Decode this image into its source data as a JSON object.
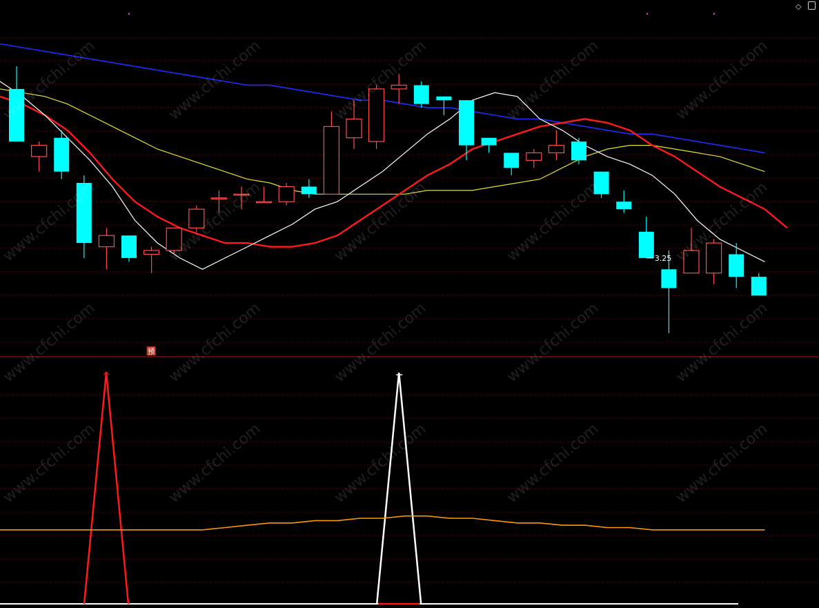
{
  "watermark_text": "www.cfchi.com",
  "colors": {
    "background": "#000000",
    "up": "#ff4c4c",
    "down": "#00ffff",
    "ma_short": "#ffffff",
    "ma_mid": "#ff1a1a",
    "ma_long": "#e6e22a",
    "ma_longest": "#1f2cff",
    "signal_red": "#ff1a1a",
    "signal_white": "#ffffff",
    "indicator_line": "#ff9900",
    "grid": "#7a1010",
    "divider": "#b01a1a"
  },
  "icons": {
    "corner_left": "diamond-icon",
    "corner_right": "square-icon"
  },
  "main_chart": {
    "low_label": "3.25",
    "low_marker_bar": 28,
    "pre_marker_label": "预",
    "pre_marker_bar": 6,
    "candles": [
      {
        "o": 3.9,
        "h": 3.96,
        "l": 3.76,
        "c": 3.76
      },
      {
        "o": 3.72,
        "h": 3.76,
        "l": 3.68,
        "c": 3.75
      },
      {
        "o": 3.77,
        "h": 3.79,
        "l": 3.66,
        "c": 3.68
      },
      {
        "o": 3.65,
        "h": 3.67,
        "l": 3.45,
        "c": 3.49
      },
      {
        "o": 3.48,
        "h": 3.53,
        "l": 3.42,
        "c": 3.51
      },
      {
        "o": 3.51,
        "h": 3.51,
        "l": 3.44,
        "c": 3.45
      },
      {
        "o": 3.46,
        "h": 3.48,
        "l": 3.41,
        "c": 3.47
      },
      {
        "o": 3.47,
        "h": 3.53,
        "l": 3.46,
        "c": 3.53
      },
      {
        "o": 3.53,
        "h": 3.59,
        "l": 3.52,
        "c": 3.58
      },
      {
        "o": 3.61,
        "h": 3.63,
        "l": 3.57,
        "c": 3.61
      },
      {
        "o": 3.62,
        "h": 3.64,
        "l": 3.58,
        "c": 3.62
      },
      {
        "o": 3.6,
        "h": 3.64,
        "l": 3.6,
        "c": 3.6
      },
      {
        "o": 3.6,
        "h": 3.65,
        "l": 3.59,
        "c": 3.64
      },
      {
        "o": 3.64,
        "h": 3.66,
        "l": 3.61,
        "c": 3.62
      },
      {
        "o": 3.62,
        "h": 3.84,
        "l": 3.62,
        "c": 3.8
      },
      {
        "o": 3.77,
        "h": 3.87,
        "l": 3.74,
        "c": 3.82
      },
      {
        "o": 3.76,
        "h": 3.91,
        "l": 3.74,
        "c": 3.9
      },
      {
        "o": 3.9,
        "h": 3.94,
        "l": 3.86,
        "c": 3.91
      },
      {
        "o": 3.91,
        "h": 3.92,
        "l": 3.85,
        "c": 3.86
      },
      {
        "o": 3.88,
        "h": 3.88,
        "l": 3.83,
        "c": 3.87
      },
      {
        "o": 3.87,
        "h": 3.87,
        "l": 3.71,
        "c": 3.75
      },
      {
        "o": 3.77,
        "h": 3.77,
        "l": 3.73,
        "c": 3.75
      },
      {
        "o": 3.73,
        "h": 3.73,
        "l": 3.67,
        "c": 3.69
      },
      {
        "o": 3.71,
        "h": 3.74,
        "l": 3.69,
        "c": 3.73
      },
      {
        "o": 3.73,
        "h": 3.79,
        "l": 3.71,
        "c": 3.75
      },
      {
        "o": 3.76,
        "h": 3.77,
        "l": 3.7,
        "c": 3.71
      },
      {
        "o": 3.68,
        "h": 3.68,
        "l": 3.61,
        "c": 3.62
      },
      {
        "o": 3.6,
        "h": 3.63,
        "l": 3.57,
        "c": 3.58
      },
      {
        "o": 3.52,
        "h": 3.56,
        "l": 3.45,
        "c": 3.45
      },
      {
        "o": 3.42,
        "h": 3.47,
        "l": 3.25,
        "c": 3.37
      },
      {
        "o": 3.41,
        "h": 3.53,
        "l": 3.41,
        "c": 3.47
      },
      {
        "o": 3.41,
        "h": 3.5,
        "l": 3.38,
        "c": 3.49
      },
      {
        "o": 3.46,
        "h": 3.49,
        "l": 3.37,
        "c": 3.4
      },
      {
        "o": 3.4,
        "h": 3.41,
        "l": 3.35,
        "c": 3.35
      }
    ],
    "ma_short": [
      3.92,
      3.88,
      3.83,
      3.77,
      3.71,
      3.64,
      3.55,
      3.49,
      3.45,
      3.42,
      3.45,
      3.48,
      3.51,
      3.54,
      3.58,
      3.6,
      3.64,
      3.68,
      3.73,
      3.78,
      3.82,
      3.87,
      3.89,
      3.88,
      3.82,
      3.79,
      3.75,
      3.72,
      3.7,
      3.67,
      3.62,
      3.55,
      3.5,
      3.47,
      3.44
    ],
    "ma_mid": [
      3.88,
      3.86,
      3.83,
      3.79,
      3.73,
      3.66,
      3.6,
      3.56,
      3.53,
      3.51,
      3.49,
      3.49,
      3.48,
      3.48,
      3.49,
      3.51,
      3.55,
      3.59,
      3.63,
      3.67,
      3.7,
      3.74,
      3.76,
      3.78,
      3.8,
      3.81,
      3.82,
      3.81,
      3.79,
      3.75,
      3.72,
      3.68,
      3.64,
      3.61,
      3.58,
      3.53
    ],
    "ma_long": [
      3.9,
      3.89,
      3.88,
      3.86,
      3.83,
      3.8,
      3.77,
      3.74,
      3.72,
      3.7,
      3.68,
      3.66,
      3.65,
      3.63,
      3.62,
      3.62,
      3.62,
      3.62,
      3.62,
      3.63,
      3.63,
      3.63,
      3.64,
      3.65,
      3.66,
      3.69,
      3.72,
      3.74,
      3.75,
      3.75,
      3.74,
      3.73,
      3.72,
      3.7,
      3.68
    ],
    "ma_longest": [
      4.02,
      4.01,
      4.0,
      3.99,
      3.98,
      3.97,
      3.96,
      3.95,
      3.94,
      3.93,
      3.92,
      3.91,
      3.91,
      3.9,
      3.89,
      3.88,
      3.87,
      3.87,
      3.86,
      3.85,
      3.85,
      3.84,
      3.83,
      3.82,
      3.82,
      3.81,
      3.8,
      3.79,
      3.78,
      3.78,
      3.77,
      3.76,
      3.75,
      3.74,
      3.73
    ]
  },
  "chart_data": {
    "type": "candlestick",
    "title": "",
    "xlabel": "",
    "ylabel": "",
    "ylim": [
      3.2,
      4.1
    ],
    "grid": true,
    "notes_in_chart": [
      "3.25",
      "预"
    ]
  },
  "indicator": {
    "ylim": [
      0,
      100
    ],
    "baseline": [
      0,
      0,
      0,
      0,
      0,
      0,
      0,
      0,
      0,
      0,
      0,
      0,
      0,
      0,
      0,
      0,
      0,
      0,
      0,
      0,
      0,
      0,
      0,
      0,
      0,
      0,
      0,
      0,
      0,
      0,
      0,
      0,
      0,
      0,
      0
    ],
    "signal_red": {
      "center_bar": 5,
      "height": 100
    },
    "signal_white": {
      "center_bar": 17,
      "height": 100
    },
    "smooth_line": [
      32,
      32,
      32,
      32,
      32,
      32,
      32,
      32,
      32,
      32,
      33,
      34,
      35,
      35,
      36,
      36,
      37,
      37,
      38,
      38,
      37,
      37,
      36,
      35,
      35,
      34,
      34,
      33,
      33,
      32,
      32,
      32,
      32,
      32,
      32
    ]
  }
}
